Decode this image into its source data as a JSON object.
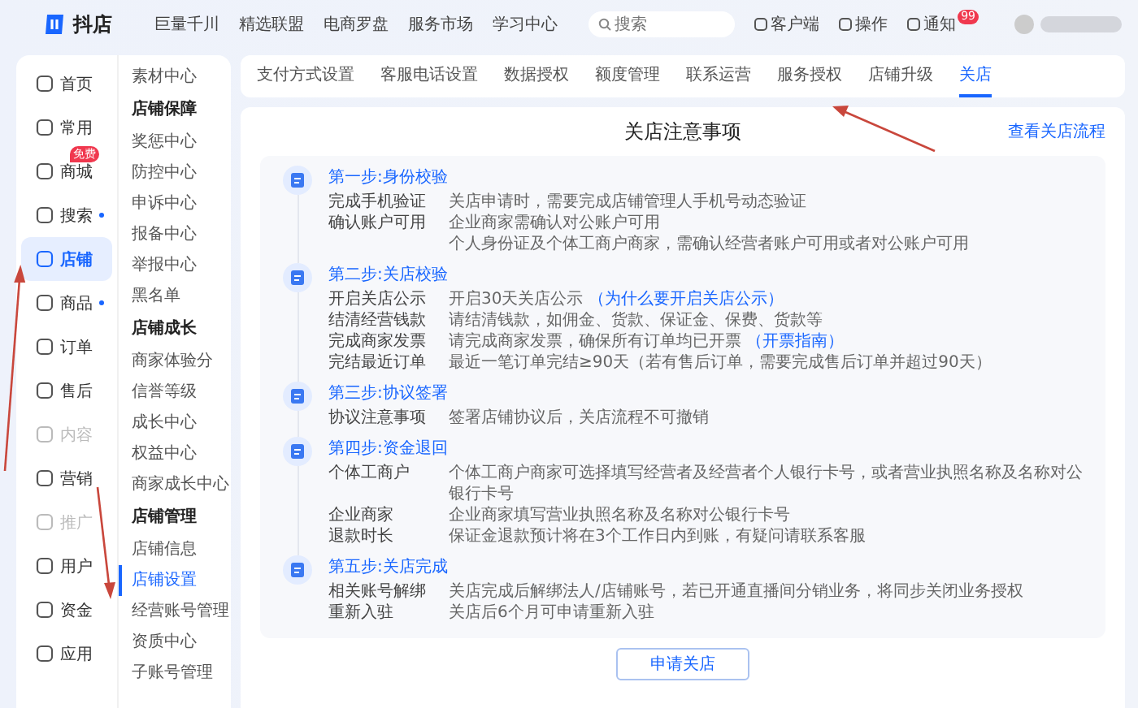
{
  "top_bar": {
    "logo": "抖店",
    "nav": [
      "巨量千川",
      "精选联盟",
      "电商罗盘",
      "服务市场",
      "学习中心"
    ],
    "search": {
      "placeholder": "搜索"
    },
    "actions": [
      {
        "label": "客户端"
      },
      {
        "label": "操作"
      },
      {
        "label": "通知",
        "badge": "99"
      }
    ]
  },
  "sidebar": {
    "nav_items": [
      {
        "label": "首页",
        "selected": false,
        "disabled": false,
        "dot": false
      },
      {
        "label": "常用",
        "selected": false,
        "disabled": false,
        "dot": false
      },
      {
        "label": "商城",
        "selected": false,
        "disabled": false,
        "dot": false,
        "badge": "免费"
      },
      {
        "label": "搜索",
        "selected": false,
        "disabled": false,
        "dot": true
      },
      {
        "label": "店铺",
        "selected": true,
        "disabled": false,
        "dot": false
      },
      {
        "label": "商品",
        "selected": false,
        "disabled": false,
        "dot": true
      },
      {
        "label": "订单",
        "selected": false,
        "disabled": false,
        "dot": false
      },
      {
        "label": "售后",
        "selected": false,
        "disabled": false,
        "dot": false
      },
      {
        "label": "内容",
        "selected": false,
        "disabled": true,
        "dot": false
      },
      {
        "label": "营销",
        "selected": false,
        "disabled": false,
        "dot": false
      },
      {
        "label": "推广",
        "selected": false,
        "disabled": true,
        "dot": false
      },
      {
        "label": "用户",
        "selected": false,
        "disabled": false,
        "dot": false
      },
      {
        "label": "资金",
        "selected": false,
        "disabled": false,
        "dot": false
      },
      {
        "label": "应用",
        "selected": false,
        "disabled": false,
        "dot": false
      }
    ],
    "sub_menu": [
      {
        "kind": "item",
        "label": "素材中心",
        "selected": false
      },
      {
        "kind": "group",
        "label": "店铺保障"
      },
      {
        "kind": "item",
        "label": "奖惩中心",
        "selected": false
      },
      {
        "kind": "item",
        "label": "防控中心",
        "selected": false
      },
      {
        "kind": "item",
        "label": "申诉中心",
        "selected": false
      },
      {
        "kind": "item",
        "label": "报备中心",
        "selected": false
      },
      {
        "kind": "item",
        "label": "举报中心",
        "selected": false
      },
      {
        "kind": "item",
        "label": "黑名单",
        "selected": false
      },
      {
        "kind": "group",
        "label": "店铺成长"
      },
      {
        "kind": "item",
        "label": "商家体验分",
        "selected": false
      },
      {
        "kind": "item",
        "label": "信誉等级",
        "selected": false
      },
      {
        "kind": "item",
        "label": "成长中心",
        "selected": false
      },
      {
        "kind": "item",
        "label": "权益中心",
        "selected": false
      },
      {
        "kind": "item",
        "label": "商家成长中心",
        "selected": false
      },
      {
        "kind": "group",
        "label": "店铺管理"
      },
      {
        "kind": "item",
        "label": "店铺信息",
        "selected": false
      },
      {
        "kind": "item",
        "label": "店铺设置",
        "selected": true
      },
      {
        "kind": "item",
        "label": "经营账号管理",
        "selected": false
      },
      {
        "kind": "item",
        "label": "资质中心",
        "selected": false
      },
      {
        "kind": "item",
        "label": "子账号管理",
        "selected": false
      }
    ]
  },
  "tabs": [
    {
      "label": "支付方式设置",
      "selected": false
    },
    {
      "label": "客服电话设置",
      "selected": false
    },
    {
      "label": "数据授权",
      "selected": false
    },
    {
      "label": "额度管理",
      "selected": false
    },
    {
      "label": "联系运营",
      "selected": false
    },
    {
      "label": "服务授权",
      "selected": false
    },
    {
      "label": "店铺升级",
      "selected": false
    },
    {
      "label": "关店",
      "selected": true
    }
  ],
  "notice": {
    "title": "关店注意事项",
    "link": "查看关店流程",
    "steps": [
      {
        "title": "第一步:身份校验",
        "rows": [
          {
            "label": "完成手机验证",
            "value": "关店申请时，需要完成店铺管理人手机号动态验证"
          },
          {
            "label": "确认账户可用",
            "value": "企业商家需确认对公账户可用"
          },
          {
            "value": "个人身份证及个体工商户商家，需确认经营者账户可用或者对公账户可用"
          }
        ]
      },
      {
        "title": "第二步:关店校验",
        "rows": [
          {
            "label": "开启关店公示",
            "value": "开启30天关店公示 ",
            "link": "（为什么要开启关店公示）"
          },
          {
            "label": "结清经营钱款",
            "value": "请结清钱款，如佣金、货款、保证金、保费、货款等"
          },
          {
            "label": "完成商家发票",
            "value": "请完成商家发票，确保所有订单均已开票 ",
            "link": "（开票指南）"
          },
          {
            "label": "完结最近订单",
            "value": "最近一笔订单完结≥90天（若有售后订单，需要完成售后订单并超过90天）"
          }
        ]
      },
      {
        "title": "第三步:协议签署",
        "rows": [
          {
            "label": "协议注意事项",
            "value": "签署店铺协议后，关店流程不可撤销"
          }
        ]
      },
      {
        "title": "第四步:资金退回",
        "rows": [
          {
            "label": "个体工商户",
            "value": "个体工商户商家可选择填写经营者及经营者个人银行卡号，或者营业执照名称及名称对公银行卡号"
          },
          {
            "label": "企业商家",
            "value": "企业商家填写营业执照名称及名称对公银行卡号"
          },
          {
            "label": "退款时长",
            "value": "保证金退款预计将在3个工作日内到账，有疑问请联系客服"
          }
        ]
      },
      {
        "title": "第五步:关店完成",
        "rows": [
          {
            "label": "相关账号解绑",
            "value": "关店完成后解绑法人/店铺账号，若已开通直播间分销业务，将同步关闭业务授权"
          },
          {
            "label": "重新入驻",
            "value": "关店后6个月可申请重新入驻"
          }
        ]
      }
    ],
    "button": "申请关店"
  }
}
